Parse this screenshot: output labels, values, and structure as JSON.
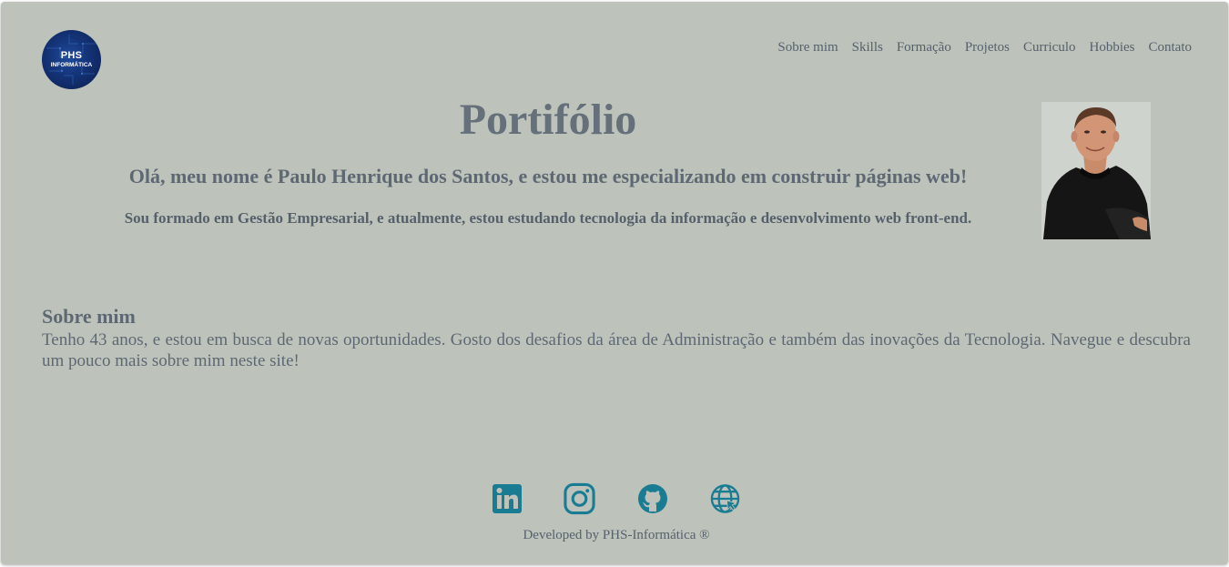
{
  "logo": {
    "line1": "PHS",
    "line2": "INFORMÁTICA"
  },
  "nav": {
    "items": [
      "Sobre mim",
      "Skills",
      "Formação",
      "Projetos",
      "Curriculo",
      "Hobbies",
      "Contato"
    ]
  },
  "hero": {
    "title": "Portifólio",
    "subtitle": "Olá, meu nome é Paulo Henrique dos Santos, e estou me especializando em construir páginas web!",
    "description": "Sou formado em Gestão Empresarial, e atualmente, estou estudando tecnologia da informação e desenvolvimento web front-end."
  },
  "about": {
    "title": "Sobre mim",
    "text": "Tenho 43 anos, e estou em busca de novas oportunidades. Gosto dos desafios da área de Administração e também das inovações da Tecnologia. Navegue e descubra um pouco mais sobre mim neste site!"
  },
  "social": {
    "icons": [
      "linkedin-icon",
      "instagram-icon",
      "github-icon",
      "globe-icon"
    ],
    "color": "#1a7c93"
  },
  "footer": {
    "text": "Developed by PHS-Informática ®"
  },
  "colors": {
    "background": "#bdc3bb",
    "text": "#5e6873",
    "accent": "#1a7c93"
  }
}
